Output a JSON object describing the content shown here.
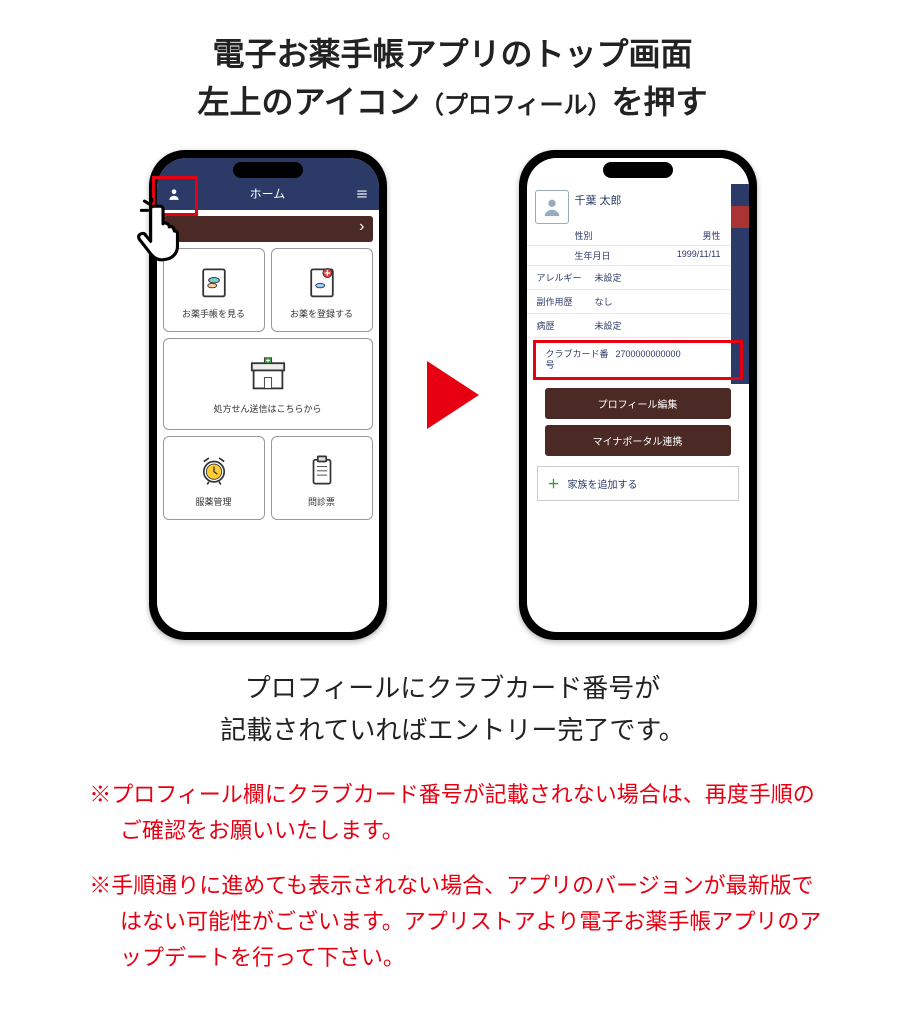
{
  "heading": {
    "line1": "電子お薬手帳アプリのトップ画面",
    "line2a": "左上のアイコン",
    "line2b": "（プロフィール）",
    "line2c": "を押す"
  },
  "left_phone": {
    "topbar_title": "ホーム",
    "cards": {
      "view_book": "お薬手帳を見る",
      "register_med": "お薬を登録する",
      "send_rx": "処方せん送信はこちらから",
      "med_manage": "服薬管理",
      "questionnaire": "問診票"
    }
  },
  "right_phone": {
    "name": "千葉 太郎",
    "gender_label": "性別",
    "gender_value": "男性",
    "dob_label": "生年月日",
    "dob_value": "1999/11/11",
    "allergy_label": "アレルギー",
    "allergy_value": "未設定",
    "sideeffect_label": "副作用歴",
    "sideeffect_value": "なし",
    "history_label": "病歴",
    "history_value": "未設定",
    "card_label": "クラブカード番号",
    "card_value": "2700000000000",
    "btn_edit": "プロフィール編集",
    "btn_myna": "マイナポータル連携",
    "add_family": "家族を追加する"
  },
  "caption": {
    "line1": "プロフィールにクラブカード番号が",
    "line2": "記載されていればエントリー完了です。"
  },
  "notes": {
    "n1": "※プロフィール欄にクラブカード番号が記載されない場合は、再度手順のご確認をお願いいたします。",
    "n2": "※手順通りに進めても表示されない場合、アプリのバージョンが最新版ではない可能性がございます。アプリストアより電子お薬手帳アプリのアップデートを行って下さい。"
  }
}
